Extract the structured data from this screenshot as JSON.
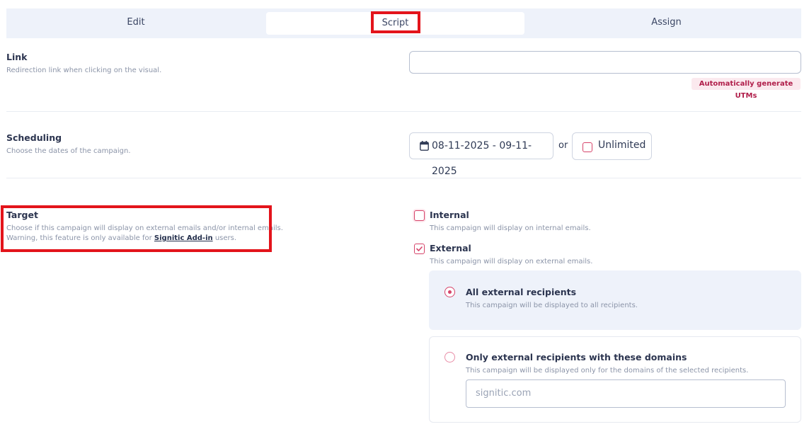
{
  "tabs": {
    "edit": "Edit",
    "script": "Script",
    "assign": "Assign"
  },
  "link": {
    "title": "Link",
    "description": "Redirection link when clicking on the visual.",
    "value": "",
    "utm_badge": "Automatically generate UTMs"
  },
  "scheduling": {
    "title": "Scheduling",
    "description": "Choose the dates of the campaign.",
    "date_range": "08-11-2025 - 09-11-2025",
    "or": "or",
    "unlimited": "Unlimited"
  },
  "target": {
    "title": "Target",
    "description_line1": "Choose if this campaign will display on external emails and/or internal emails.",
    "description_line2_prefix": "Warning, this feature is only available for ",
    "description_link": "Signitic Add-in",
    "description_line2_suffix": " users.",
    "internal": {
      "label": "Internal",
      "desc": "This campaign will display on internal emails.",
      "checked": false
    },
    "external": {
      "label": "External",
      "desc": "This campaign will display on external emails.",
      "checked": true
    },
    "all_recipients": {
      "label": "All external recipients",
      "desc": "This campaign will be displayed to all recipients.",
      "selected": true
    },
    "domain_recipients": {
      "label": "Only external recipients with these domains",
      "desc": "This campaign will be displayed only for the domains of the selected recipients.",
      "selected": false,
      "placeholder": "signitic.com"
    }
  },
  "colors": {
    "accent": "#d6446a",
    "highlight": "#e3141b",
    "tab_bg": "#eef2fa"
  }
}
